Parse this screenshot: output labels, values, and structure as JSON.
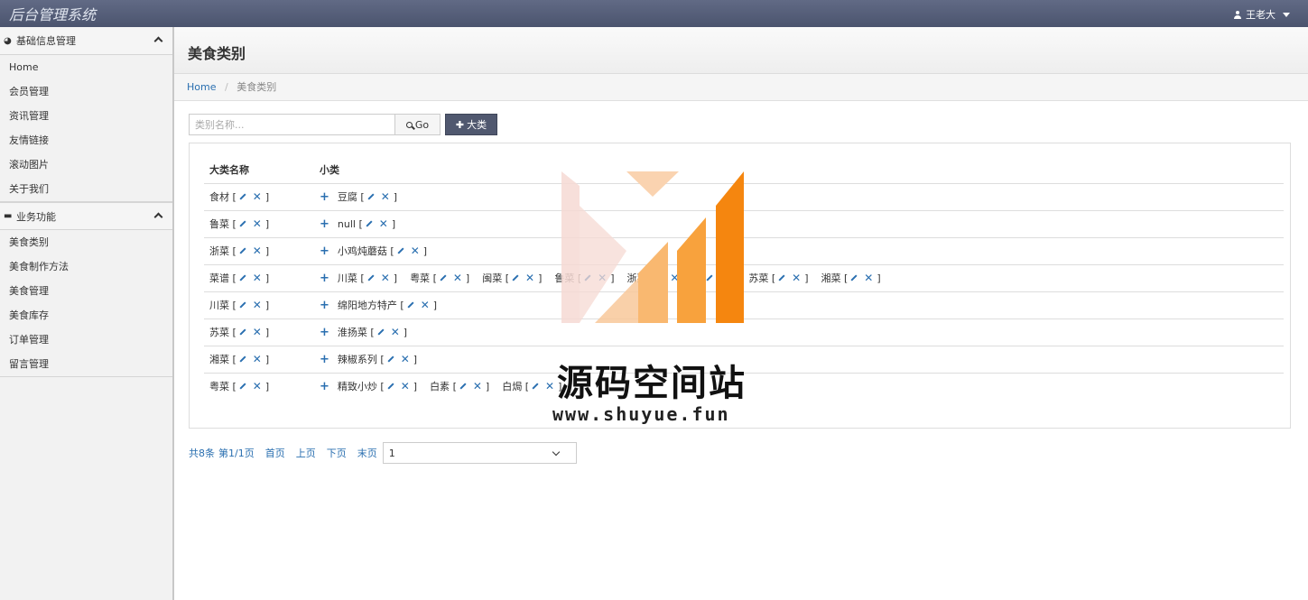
{
  "app": {
    "title": "后台管理系统",
    "user": "王老大"
  },
  "sidebar": {
    "groups": [
      {
        "label": "基础信息管理",
        "items": [
          "Home",
          "会员管理",
          "资讯管理",
          "友情链接",
          "滚动图片",
          "关于我们"
        ]
      },
      {
        "label": "业务功能",
        "items": [
          "美食类别",
          "美食制作方法",
          "美食管理",
          "美食库存",
          "订单管理",
          "留言管理"
        ]
      }
    ]
  },
  "page": {
    "title": "美食类别",
    "breadcrumb": {
      "home": "Home",
      "current": "美食类别"
    }
  },
  "toolbar": {
    "search_placeholder": "类别名称...",
    "go_label": "Go",
    "add_label": "大类"
  },
  "table": {
    "headers": [
      "大类名称",
      "小类"
    ],
    "rows": [
      {
        "name": "食材",
        "subs": [
          "豆腐"
        ]
      },
      {
        "name": "鲁菜",
        "subs": [
          "null"
        ]
      },
      {
        "name": "浙菜",
        "subs": [
          "小鸡炖蘑菇"
        ]
      },
      {
        "name": "菜谱",
        "subs": [
          "川菜",
          "粤菜",
          "闽菜",
          "鲁菜",
          "浙菜",
          "",
          "苏菜",
          "湘菜"
        ]
      },
      {
        "name": "川菜",
        "subs": [
          "绵阳地方特产"
        ]
      },
      {
        "name": "苏菜",
        "subs": [
          "淮扬菜"
        ]
      },
      {
        "name": "湘菜",
        "subs": [
          "辣椒系列"
        ]
      },
      {
        "name": "粤菜",
        "subs": [
          "精致小炒",
          "白素",
          "白焗"
        ]
      }
    ]
  },
  "pager": {
    "total": "共8条",
    "page_info": "第1/1页",
    "first": "首页",
    "prev": "上页",
    "next": "下页",
    "last": "末页",
    "selected": "1"
  },
  "watermark": {
    "name": "源码空间站",
    "url": "www.shuyue.fun"
  }
}
